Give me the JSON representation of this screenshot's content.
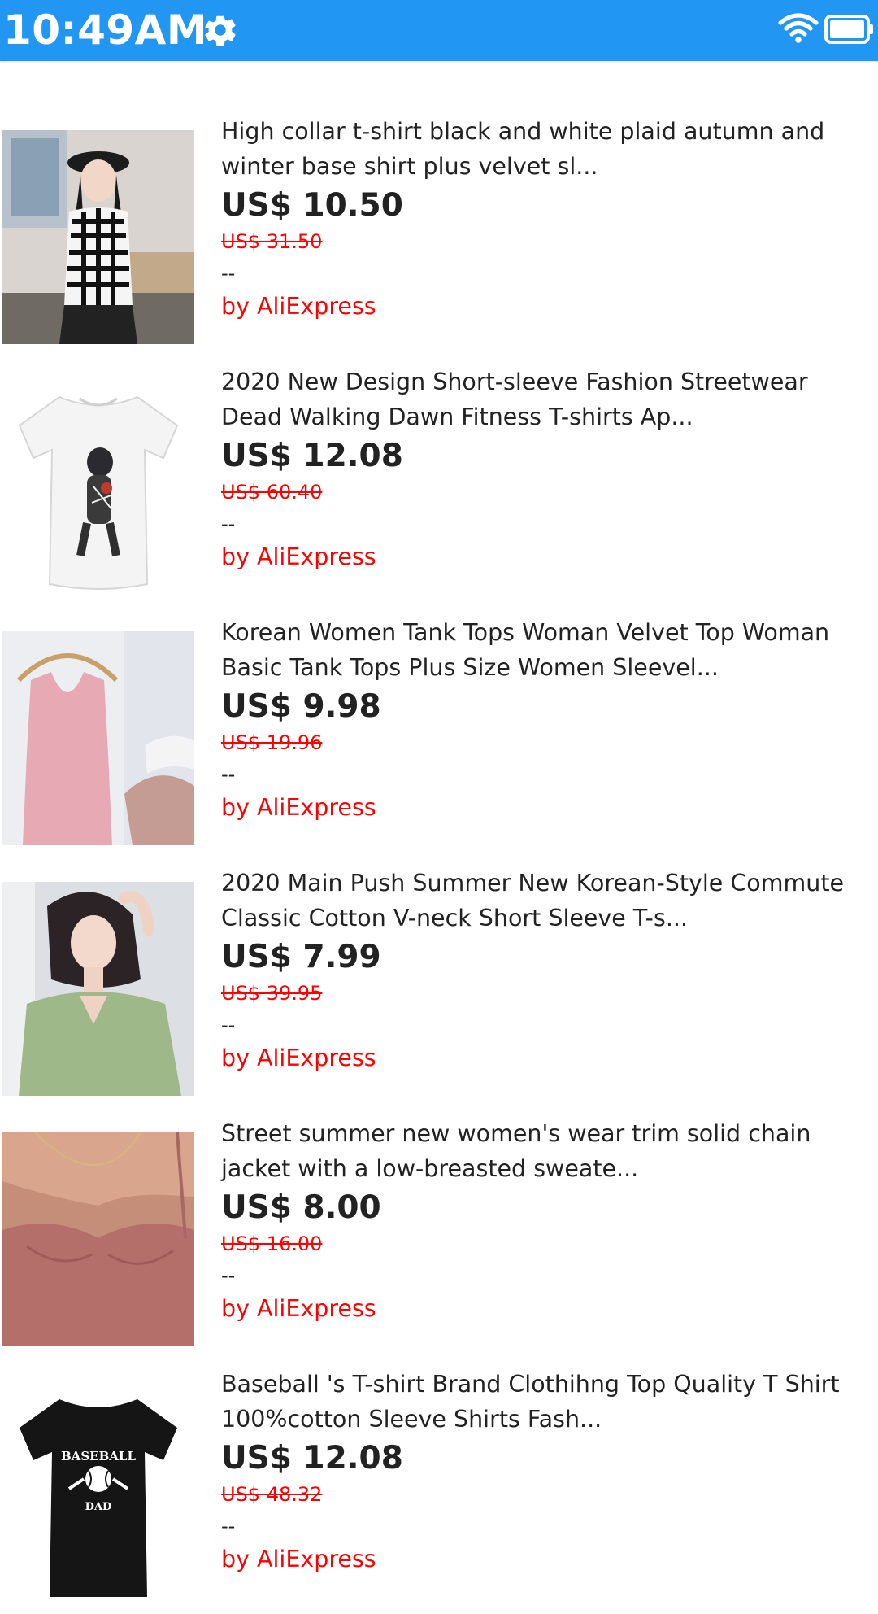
{
  "status_bar": {
    "time": "10:49AM",
    "background": "#2196f3",
    "icons": [
      "gear-icon",
      "wifi-icon",
      "battery-icon"
    ]
  },
  "products": [
    {
      "title": "High collar t-shirt black and white plaid autumn and winter base shirt plus velvet sl...",
      "price": "US$ 10.50",
      "original_price": "US$ 31.50",
      "rating": "--",
      "seller": "by AliExpress"
    },
    {
      "title": "2020 New Design Short-sleeve Fashion Streetwear Dead Walking Dawn Fitness T-shirts Ap...",
      "price": "US$ 12.08",
      "original_price": "US$ 60.40",
      "rating": "--",
      "seller": "by AliExpress"
    },
    {
      "title": "Korean Women Tank Tops Woman Velvet Top Woman Basic Tank Tops Plus Size Women Sleevel...",
      "price": "US$ 9.98",
      "original_price": "US$ 19.96",
      "rating": "--",
      "seller": "by AliExpress"
    },
    {
      "title": "2020 Main Push Summer New Korean-Style Commute Classic Cotton V-neck Short Sleeve T-s...",
      "price": "US$ 7.99",
      "original_price": "US$ 39.95",
      "rating": "--",
      "seller": "by AliExpress"
    },
    {
      "title": "Street summer new women's wear trim solid chain jacket with a low-breasted sweate...",
      "price": "US$ 8.00",
      "original_price": "US$ 16.00",
      "rating": "--",
      "seller": "by AliExpress"
    },
    {
      "title": "Baseball 's T-shirt Brand Clothihng Top Quality T Shirt 100%cotton Sleeve Shirts Fash...",
      "price": "US$ 12.08",
      "original_price": "US$ 48.32",
      "rating": "--",
      "seller": "by AliExpress",
      "shirt_print": [
        "BASEBALL",
        "DAD"
      ]
    }
  ],
  "colors": {
    "accent": "#2196f3",
    "seller": "#ff0000",
    "original_price": "#ff0000",
    "text": "#222222"
  }
}
